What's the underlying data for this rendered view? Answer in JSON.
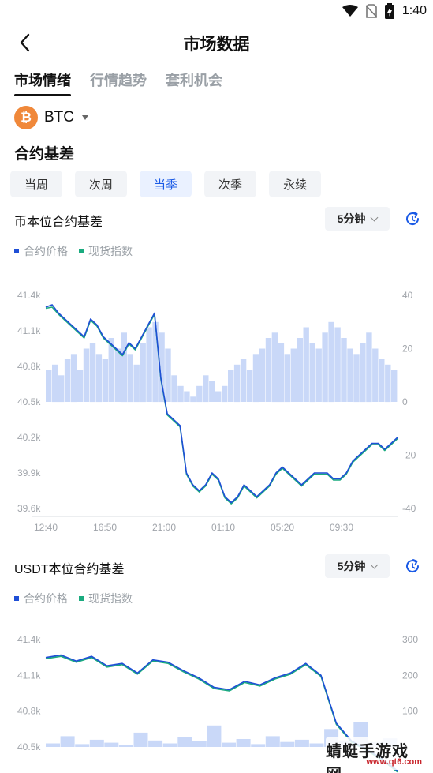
{
  "status": {
    "time": "1:40"
  },
  "header": {
    "title": "市场数据"
  },
  "tabs": [
    {
      "label": "市场情绪",
      "active": true
    },
    {
      "label": "行情趋势",
      "active": false
    },
    {
      "label": "套利机会",
      "active": false
    }
  ],
  "coin": {
    "symbol": "BTC",
    "logo_glyph": "₿",
    "logo_color": "#f0883a"
  },
  "section": {
    "title": "合约基差"
  },
  "periods": [
    {
      "label": "当周",
      "active": false
    },
    {
      "label": "次周",
      "active": false
    },
    {
      "label": "当季",
      "active": true
    },
    {
      "label": "次季",
      "active": false
    },
    {
      "label": "永续",
      "active": false
    }
  ],
  "colors": {
    "accent": "#1a5ae6",
    "contract_price": "#1f4fd6",
    "spot_index": "#1aab7f",
    "basis_fill": "#c9d8f8"
  },
  "legend": {
    "contract_price": "合约价格",
    "spot_index": "现货指数"
  },
  "charts": [
    {
      "title": "币本位合约基差",
      "interval": "5分钟"
    },
    {
      "title": "USDT本位合约基差",
      "interval": "5分钟"
    }
  ],
  "chart_data": [
    {
      "type": "line",
      "title": "币本位合约基差",
      "x_tick_labels": [
        "12:40",
        "16:50",
        "21:00",
        "01:10",
        "05:20",
        "09:30"
      ],
      "y_left_ticks": [
        "41.4k",
        "41.1k",
        "40.8k",
        "40.5k",
        "40.2k",
        "39.9k",
        "39.6k"
      ],
      "y_left_range": [
        39600,
        41400
      ],
      "y_right_ticks": [
        "40",
        "20",
        "0",
        "-20",
        "-40"
      ],
      "y_right_range": [
        -40,
        40
      ],
      "series": [
        {
          "name": "合约价格",
          "values": [
            41300,
            41320,
            41250,
            41200,
            41150,
            41100,
            41050,
            41200,
            41150,
            41050,
            41000,
            40950,
            40900,
            41000,
            40950,
            41050,
            41150,
            41250,
            40700,
            40400,
            40350,
            40300,
            39900,
            39800,
            39750,
            39800,
            39900,
            39850,
            39700,
            39650,
            39700,
            39800,
            39750,
            39700,
            39750,
            39800,
            39900,
            39950,
            39900,
            39850,
            39800,
            39850,
            39900,
            39900,
            39900,
            39850,
            39850,
            39900,
            40000,
            40050,
            40100,
            40150,
            40150,
            40100,
            40150,
            40200
          ]
        },
        {
          "name": "现货指数",
          "values": [
            41290,
            41300,
            41240,
            41190,
            41140,
            41090,
            41040,
            41190,
            41140,
            41040,
            40990,
            40940,
            40890,
            40990,
            40940,
            41040,
            41140,
            41240,
            40690,
            40390,
            40340,
            40290,
            39890,
            39790,
            39740,
            39790,
            39890,
            39840,
            39690,
            39640,
            39690,
            39790,
            39740,
            39690,
            39740,
            39790,
            39890,
            39940,
            39890,
            39840,
            39790,
            39840,
            39890,
            39890,
            39890,
            39840,
            39840,
            39890,
            39990,
            40040,
            40090,
            40140,
            40140,
            40090,
            40140,
            40190
          ]
        },
        {
          "name": "基差",
          "values": [
            12,
            14,
            10,
            16,
            18,
            12,
            20,
            22,
            18,
            16,
            24,
            20,
            26,
            18,
            14,
            22,
            28,
            30,
            26,
            20,
            10,
            6,
            4,
            2,
            6,
            10,
            8,
            4,
            6,
            12,
            14,
            16,
            12,
            18,
            20,
            24,
            26,
            22,
            18,
            20,
            24,
            28,
            22,
            20,
            26,
            30,
            28,
            24,
            20,
            18,
            22,
            26,
            20,
            16,
            14,
            12
          ]
        }
      ]
    },
    {
      "type": "line",
      "title": "USDT本位合约基差",
      "y_left_ticks": [
        "41.4k",
        "41.1k",
        "40.8k",
        "40.5k"
      ],
      "y_left_range": [
        40500,
        41400
      ],
      "y_right_ticks": [
        "300",
        "200",
        "100"
      ],
      "y_right_range": [
        0,
        300
      ],
      "series": [
        {
          "name": "合约价格",
          "values": [
            41250,
            41270,
            41220,
            41260,
            41180,
            41200,
            41120,
            41230,
            41210,
            41140,
            41080,
            41000,
            40980,
            41050,
            41020,
            41080,
            41120,
            41200,
            41100,
            40700,
            40550,
            40480,
            40400,
            40300
          ]
        },
        {
          "name": "现货指数",
          "values": [
            41240,
            41260,
            41210,
            41250,
            41170,
            41190,
            41110,
            41220,
            41200,
            41130,
            41070,
            40990,
            40970,
            41040,
            41010,
            41070,
            41110,
            41190,
            41090,
            40690,
            40540,
            40470,
            40390,
            40290
          ]
        },
        {
          "name": "基差",
          "values": [
            10,
            30,
            8,
            20,
            12,
            6,
            40,
            18,
            10,
            28,
            16,
            60,
            12,
            22,
            8,
            30,
            14,
            20,
            10,
            50,
            18,
            70,
            14,
            24
          ]
        }
      ]
    }
  ],
  "watermark": {
    "main": "蜻蜓手游戏网",
    "sub": "www.qt6.com"
  }
}
